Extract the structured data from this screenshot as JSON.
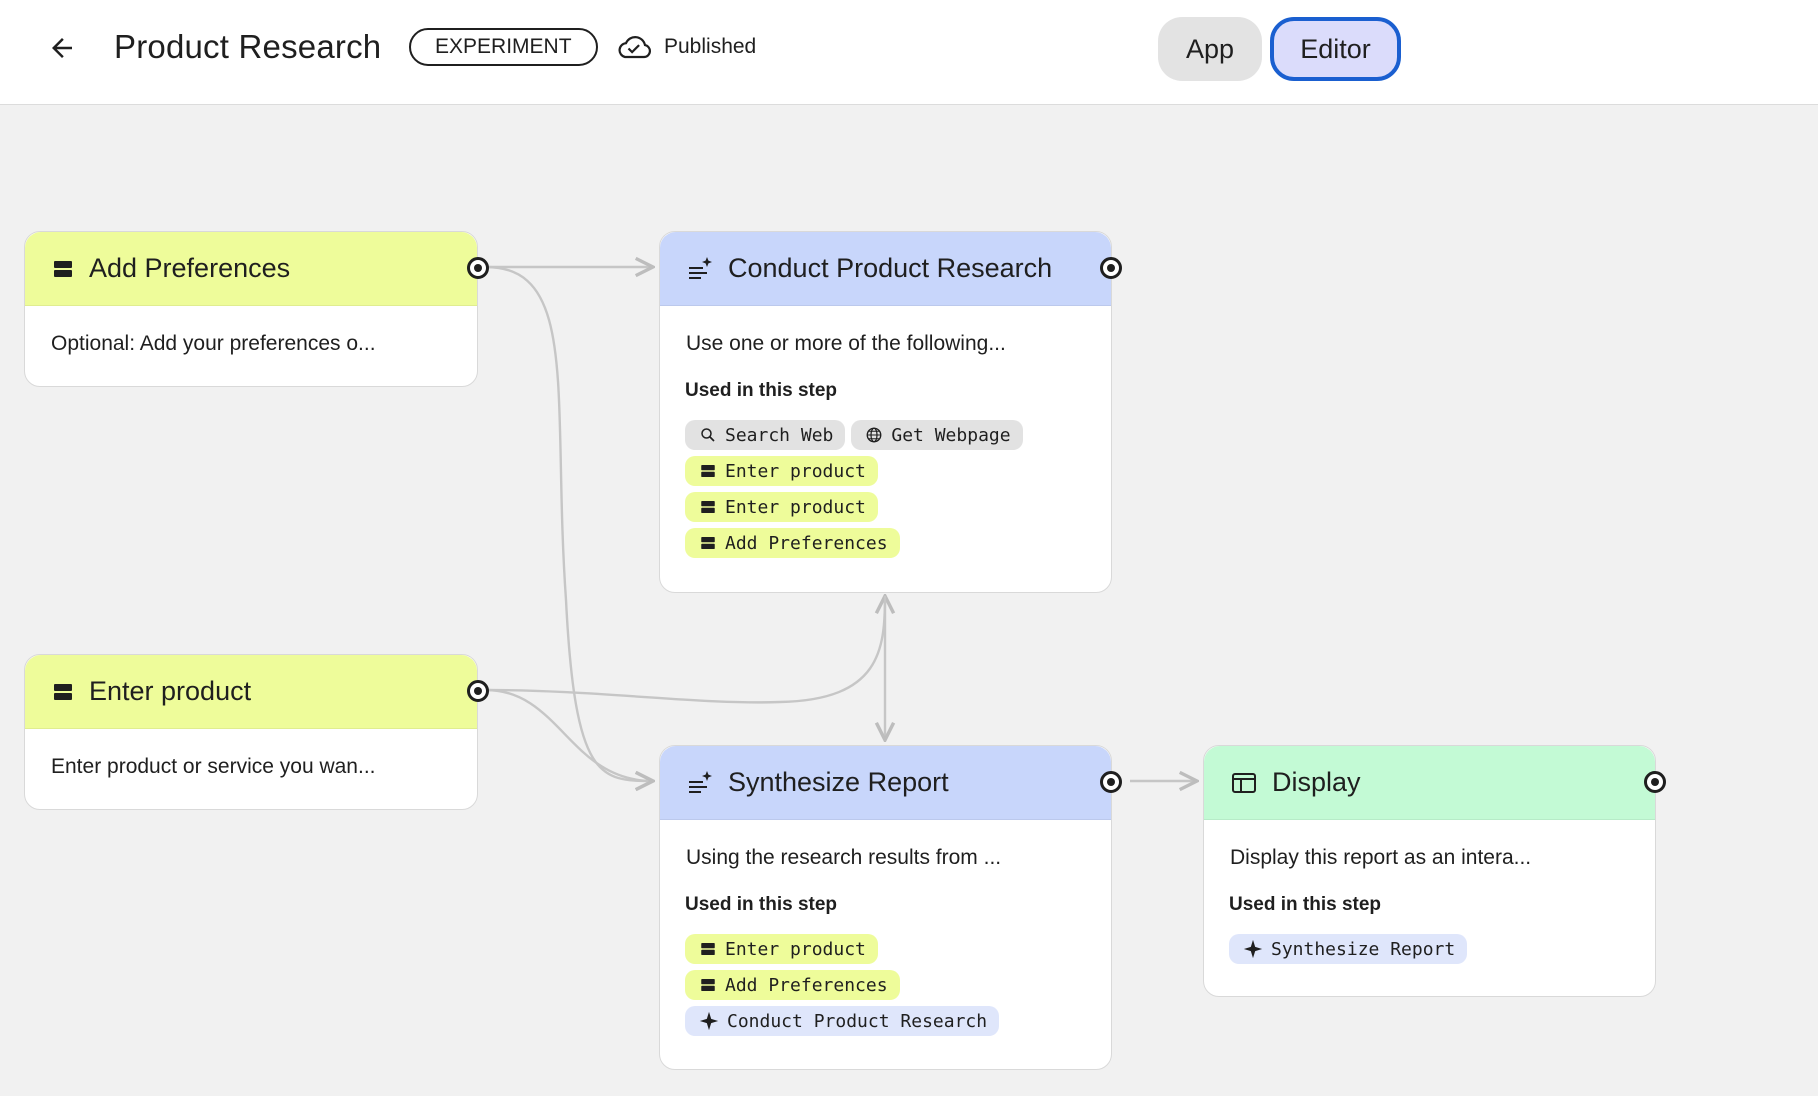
{
  "header": {
    "title": "Product Research",
    "badge": "EXPERIMENT",
    "status": "Published",
    "mode_app": "App",
    "mode_editor": "Editor",
    "active_mode": "Editor"
  },
  "nodes": {
    "add_preferences": {
      "title": "Add Preferences",
      "description": "Optional: Add your preferences o...",
      "color": "#eefc9a"
    },
    "enter_product": {
      "title": "Enter product",
      "description": "Enter product or service you wan...",
      "color": "#eefc9a"
    },
    "conduct_research": {
      "title": "Conduct Product Research",
      "description": "Use one or more of the following...",
      "used_label": "Used in this step",
      "chips": [
        "Search Web",
        "Get Webpage",
        "Enter product",
        "Enter product",
        "Add Preferences"
      ],
      "color": "#c8d6fb"
    },
    "synthesize_report": {
      "title": "Synthesize Report",
      "description": "Using the research results from ...",
      "used_label": "Used in this step",
      "chips": [
        "Enter product",
        "Add Preferences",
        "Conduct Product Research"
      ],
      "color": "#c8d6fb"
    },
    "display": {
      "title": "Display",
      "description": "Display this report as an intera...",
      "used_label": "Used in this step",
      "chips": [
        "Synthesize Report"
      ],
      "color": "#c3fad5"
    }
  }
}
